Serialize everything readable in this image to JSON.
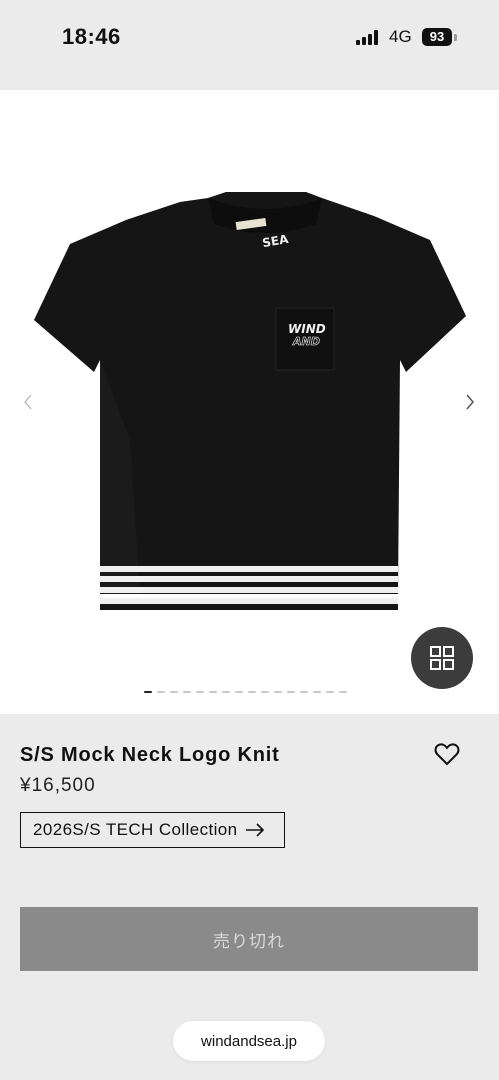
{
  "status_bar": {
    "time": "18:46",
    "network": "4G",
    "battery": "93"
  },
  "gallery": {
    "image_icon": "tshirt-image",
    "prev_icon": "chevron-left-icon",
    "next_icon": "chevron-right-icon",
    "grid_icon": "grid-icon",
    "image_count": 16,
    "active_index": 0,
    "shirt_print": {
      "collar": "SEA",
      "pocket_top": "WIND",
      "pocket_bottom": "AND"
    }
  },
  "product": {
    "title": "S/S Mock Neck Logo Knit",
    "price": "¥16,500",
    "collection_label": "2026S/S TECH Collection",
    "sold_out_label": "売り切れ"
  },
  "browser": {
    "url": "windandsea.jp"
  },
  "colors": {
    "background": "#ebebeb",
    "sold_out_button": "#8a8a8a",
    "grid_button": "#3c3c3c"
  }
}
